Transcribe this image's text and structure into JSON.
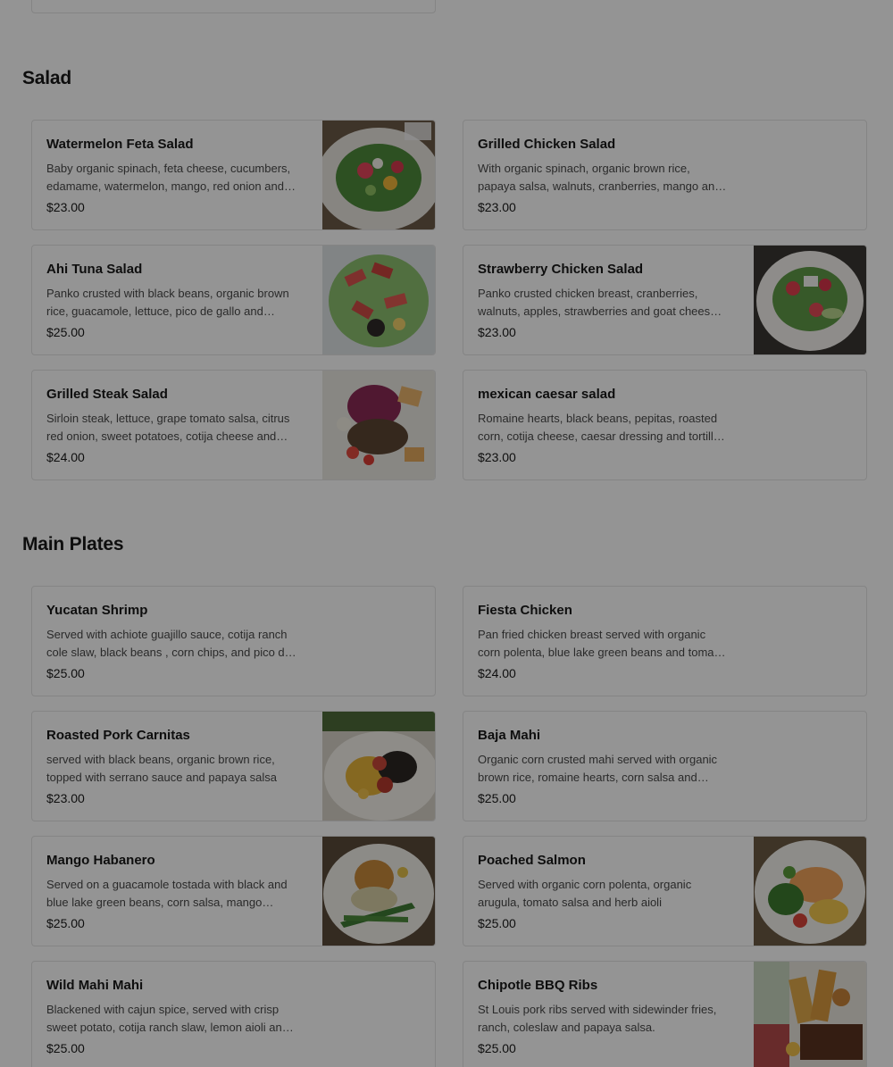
{
  "sections": [
    {
      "title": "Salad",
      "items": [
        {
          "name": "Watermelon Feta Salad",
          "description": "Baby organic spinach, feta cheese, cucumbers, edamame, watermelon, mango, red onion and balsamic vinaigrette",
          "price": "$23.00",
          "image": "salad-photo"
        },
        {
          "name": "Grilled Chicken Salad",
          "description": "With organic spinach, organic brown rice, papaya salsa, walnuts, cranberries, mango and balsamic vinaigrette",
          "price": "$23.00",
          "image": null
        },
        {
          "name": "Ahi Tuna Salad",
          "description": "Panko crusted with black beans, organic brown rice, guacamole, lettuce, pico de gallo and cilantro dressing",
          "price": "$25.00",
          "image": "tuna-salad-photo"
        },
        {
          "name": "Strawberry Chicken Salad",
          "description": "Panko crusted chicken breast, cranberries, walnuts, apples, strawberries and goat cheese with balsamic vinaigrette",
          "price": "$23.00",
          "image": "strawberry-salad-photo"
        },
        {
          "name": "Grilled Steak Salad",
          "description": "Sirloin steak, lettuce, grape tomato salsa, citrus red onion, sweet potatoes, cotija cheese and chipotle dressing",
          "price": "$24.00",
          "image": "steak-salad-photo"
        },
        {
          "name": "mexican caesar salad",
          "description": "Romaine hearts, black beans, pepitas, roasted corn, cotija cheese, caesar dressing and tortilla strips",
          "price": "$23.00",
          "image": null
        }
      ]
    },
    {
      "title": "Main Plates",
      "items": [
        {
          "name": "Yucatan Shrimp",
          "description": "Served with achiote guajillo sauce, cotija ranch cole slaw, black beans , corn chips, and pico de gallo",
          "price": "$25.00",
          "image": null
        },
        {
          "name": "Fiesta Chicken",
          "description": "Pan fried chicken breast served with organic corn polenta, blue lake green beans and tomato salsa",
          "price": "$24.00",
          "image": null
        },
        {
          "name": "Roasted Pork Carnitas",
          "description": "served with black beans, organic brown rice, topped with serrano sauce and papaya salsa",
          "price": "$23.00",
          "image": "carnitas-photo"
        },
        {
          "name": "Baja Mahi",
          "description": "Organic corn crusted mahi served with organic brown rice, romaine hearts, corn salsa and lemon aioli",
          "price": "$25.00",
          "image": null
        },
        {
          "name": "Mango Habanero",
          "description": "Served on a guacamole tostada with black and blue lake green beans, corn salsa, mango habanero sauce",
          "price": "$25.00",
          "image": "mango-habanero-photo"
        },
        {
          "name": "Poached Salmon",
          "description": "Served with organic corn polenta, organic arugula, tomato salsa and herb aioli",
          "price": "$25.00",
          "image": "salmon-photo"
        },
        {
          "name": "Wild Mahi Mahi",
          "description": "Blackened with cajun spice, served with crisp sweet potato, cotija ranch slaw, lemon aioli and salsa",
          "price": "$25.00",
          "image": null
        },
        {
          "name": "Chipotle BBQ Ribs",
          "description": "St Louis pork ribs served with sidewinder fries, ranch, coleslaw and papaya salsa.",
          "price": "$25.00",
          "image": "ribs-photo"
        }
      ]
    }
  ]
}
